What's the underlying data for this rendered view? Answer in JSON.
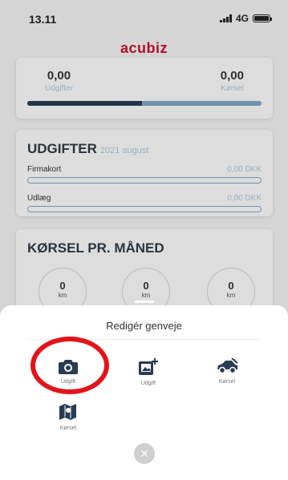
{
  "status_bar": {
    "time": "13.11",
    "network": "4G"
  },
  "app": {
    "brand": "acubiz",
    "brand_color": "#c8102e"
  },
  "summary": {
    "expenses": {
      "value": "0,00",
      "label": "Udgifter"
    },
    "mileage": {
      "value": "0,00",
      "label": "Kørsel"
    },
    "split_fraction": 0.49
  },
  "expenses_section": {
    "title": "UDGIFTER",
    "period": "2021 august",
    "rows": [
      {
        "name": "Firmakort",
        "value": "0,00 DKK"
      },
      {
        "name": "Udlæg",
        "value": "0,00 DKK"
      }
    ]
  },
  "mileage_section": {
    "title": "KØRSEL PR. MÅNED",
    "stats": [
      {
        "value": "0",
        "unit": "km"
      },
      {
        "value": "0",
        "unit": "km"
      },
      {
        "value": "0",
        "unit": "km"
      }
    ]
  },
  "sheet": {
    "title": "Redigér genveje",
    "shortcuts": [
      {
        "label": "Udgift",
        "icon": "camera-icon"
      },
      {
        "label": "Udgift",
        "icon": "image-add-icon"
      },
      {
        "label": "Kørsel",
        "icon": "car-icon"
      },
      {
        "label": "Kørsel",
        "icon": "map-icon"
      }
    ],
    "close_glyph": "✕"
  },
  "colors": {
    "highlight": "#e3131c",
    "accent_dark": "#2a3b52",
    "accent_light": "#7fa3c4"
  }
}
